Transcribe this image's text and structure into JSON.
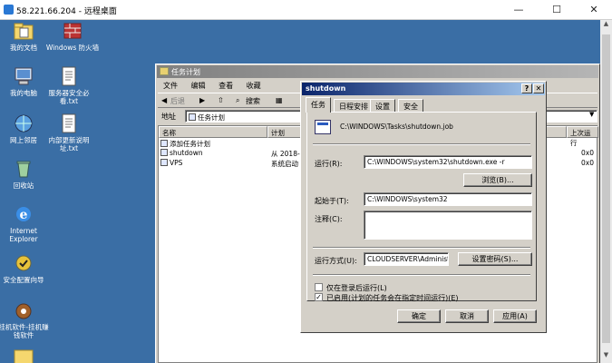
{
  "remote_window": {
    "title": "58.221.66.204 - 远程桌面",
    "minimize": "—",
    "maximize": "☐",
    "close": "✕"
  },
  "desktop_icons": [
    {
      "label": "我的文档",
      "icon": "folder-documents-icon"
    },
    {
      "label": "Windows 防火墙",
      "icon": "firewall-icon"
    },
    {
      "label": "我的电脑",
      "icon": "computer-icon"
    },
    {
      "label": "服务器安全必看.txt",
      "icon": "text-file-icon"
    },
    {
      "label": "网上邻居",
      "icon": "network-icon"
    },
    {
      "label": "内部更新说明址.txt",
      "icon": "text-file-icon"
    },
    {
      "label": "回收站",
      "icon": "recycle-bin-icon"
    },
    {
      "label": "Internet Explorer",
      "icon": "ie-icon"
    },
    {
      "label": "安全配置向导",
      "icon": "security-wizard-icon"
    },
    {
      "label": "挂机软件-挂机赚钱软件",
      "icon": "hangup-app-icon"
    }
  ],
  "task_window": {
    "title": "任务计划",
    "menu": [
      "文件",
      "编辑",
      "查看",
      "收藏"
    ],
    "toolbar": {
      "back": "后退",
      "search": "搜索"
    },
    "address_label": "地址",
    "address_value": "任务计划",
    "columns": [
      "名称",
      "计划",
      "上次运行"
    ],
    "rows": [
      {
        "name": "添加任务计划",
        "schedule": "",
        "last": ""
      },
      {
        "name": "shutdown",
        "schedule": "从 2018-",
        "last": "0x0"
      },
      {
        "name": "VPS",
        "schedule": "系统启动",
        "last": "0x0"
      }
    ]
  },
  "dialog": {
    "title": "shutdown",
    "help": "?",
    "close": "✕",
    "tabs": [
      "任务",
      "日程安排",
      "设置",
      "安全"
    ],
    "job_path": "C:\\WINDOWS\\Tasks\\shutdown.job",
    "run_label": "运行(R):",
    "run_value": "C:\\WINDOWS\\system32\\shutdown.exe -r",
    "browse_button": "浏览(B)...",
    "start_in_label": "起始于(T):",
    "start_in_value": "C:\\WINDOWS\\system32",
    "comment_label": "注释(C):",
    "comment_value": "",
    "run_as_label": "运行方式(U):",
    "run_as_value": "CLOUDSERVER\\Administra",
    "set_password_button": "设置密码(S)...",
    "only_logged_on_label": "仅在登录后运行(L)",
    "only_logged_on_checked": false,
    "enabled_label": "已启用(计划的任务会在指定时间运行)(E)",
    "enabled_checked": true,
    "ok_button": "确定",
    "cancel_button": "取消",
    "apply_button": "应用(A)"
  }
}
